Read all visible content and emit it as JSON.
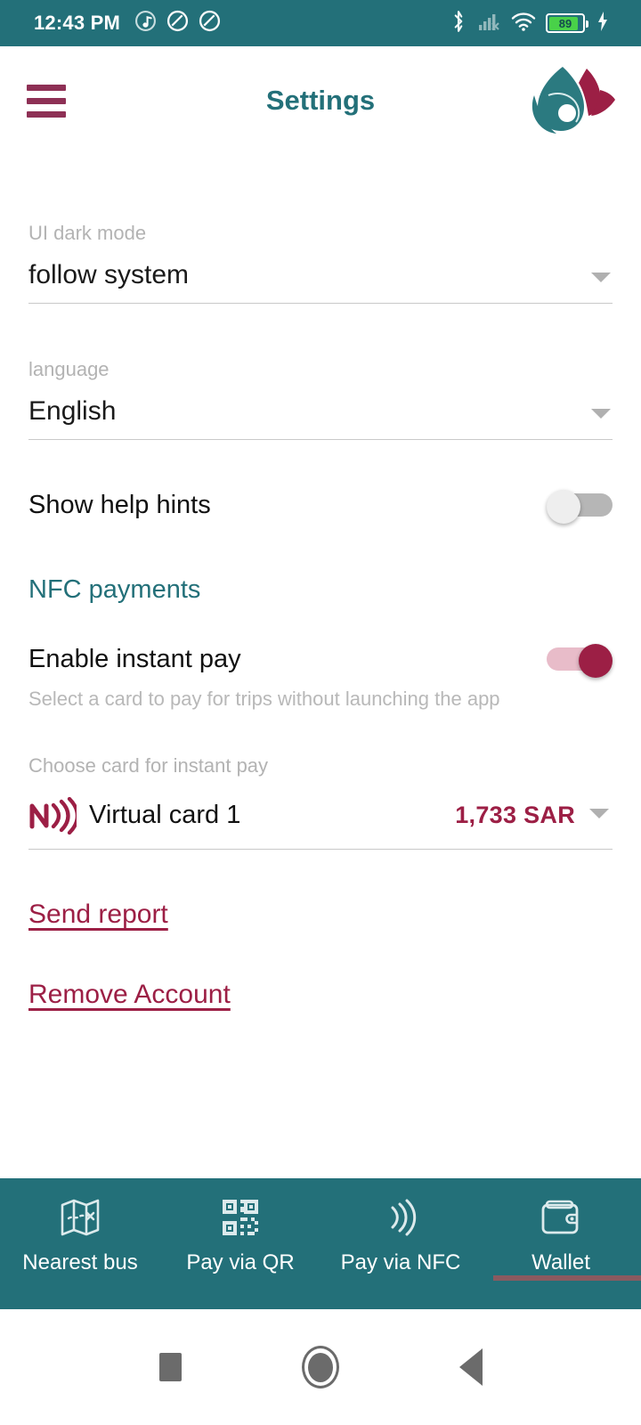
{
  "status_bar": {
    "time": "12:43 PM",
    "left_icons": [
      "music-note-icon",
      "do-not-disturb-icon",
      "do-not-disturb-icon"
    ],
    "right_icons": [
      "bluetooth-icon",
      "cellular-no-sim-icon",
      "wifi-icon",
      "battery-icon",
      "charging-bolt-icon"
    ],
    "battery_percent": "89",
    "background_color": "#237079"
  },
  "header": {
    "menu_icon": "hamburger-menu-icon",
    "title": "Settings",
    "logo_icon": "app-logo-leaf-icon",
    "title_color": "#237079",
    "accent_color": "#9c1f45"
  },
  "settings": {
    "dark_mode": {
      "label": "UI dark mode",
      "value": "follow system",
      "dropdown_icon": "chevron-down-icon"
    },
    "language": {
      "label": "language",
      "value": "English",
      "dropdown_icon": "chevron-down-icon"
    },
    "help_hints": {
      "label": "Show help hints",
      "enabled": false
    }
  },
  "nfc_section": {
    "title": "NFC payments",
    "instant_pay": {
      "label": "Enable instant pay",
      "enabled": true,
      "helper_text": "Select a card to pay for trips without launching the app"
    },
    "card_picker": {
      "label": "Choose card for instant pay",
      "icon": "nfc-wave-icon",
      "card_name": "Virtual card 1",
      "amount": "1,733 SAR",
      "dropdown_icon": "chevron-down-icon"
    }
  },
  "actions": {
    "send_report": "Send report",
    "remove_account": "Remove Account"
  },
  "bottom_nav": {
    "items": [
      {
        "label": "Nearest bus",
        "icon": "map-route-icon",
        "active": false
      },
      {
        "label": "Pay via QR",
        "icon": "qr-code-icon",
        "active": false
      },
      {
        "label": "Pay via NFC",
        "icon": "nfc-wave-icon",
        "active": false
      },
      {
        "label": "Wallet",
        "icon": "wallet-icon",
        "active": true
      }
    ],
    "background_color": "#237079"
  },
  "system_nav": {
    "recents": "recents-square-icon",
    "home": "home-circle-icon",
    "back": "back-triangle-icon"
  }
}
